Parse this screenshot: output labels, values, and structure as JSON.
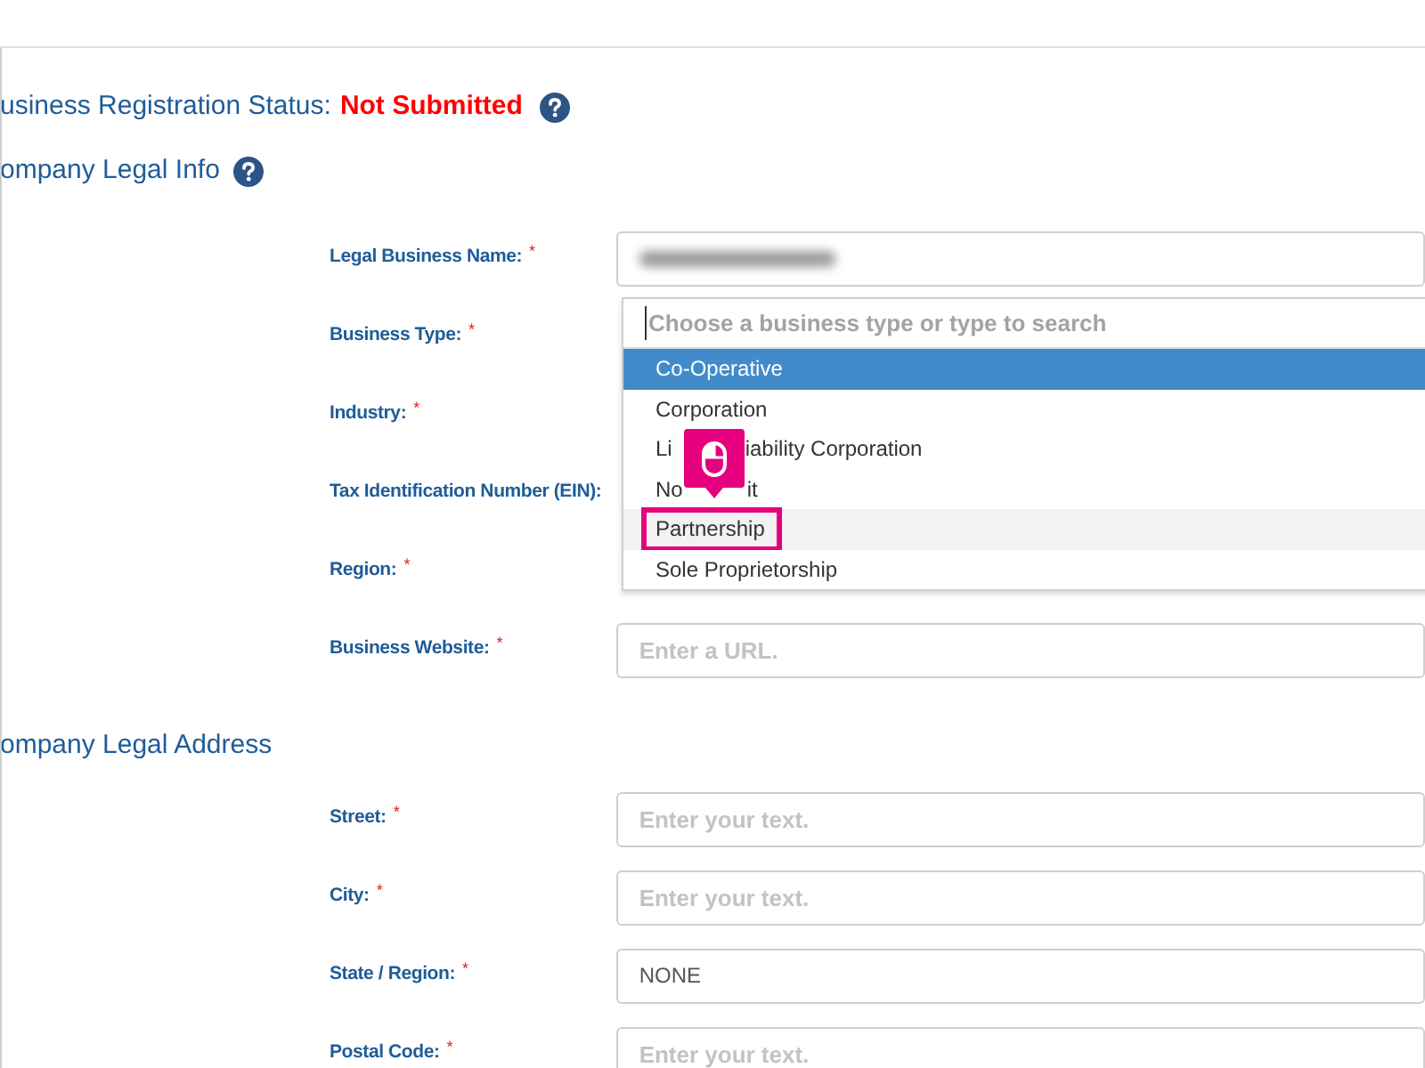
{
  "status": {
    "label": "usiness Registration Status:",
    "value": "Not Submitted",
    "help": true
  },
  "sections": [
    {
      "title": "ompany Legal Info",
      "help": true,
      "fields": [
        {
          "label": "Legal Business Name:",
          "marker": "*",
          "kind": "redacted"
        },
        {
          "label": "Business Type:",
          "marker": "*",
          "kind": "combobox",
          "placeholder": "Choose a business type or type to search",
          "options": [
            {
              "parts": [
                "Co-Operative"
              ],
              "selected": true,
              "annotated": false
            },
            {
              "parts": [
                "Corporation"
              ],
              "selected": false,
              "annotated": false
            },
            {
              "parts": [
                "Li",
                "iability Corporation"
              ],
              "selected": false,
              "annotated": false
            },
            {
              "parts": [
                "No",
                "it"
              ],
              "selected": false,
              "annotated": false
            },
            {
              "parts": [
                "Partnership"
              ],
              "selected": false,
              "annotated": true
            },
            {
              "parts": [
                "Sole Proprietorship"
              ],
              "selected": false,
              "annotated": false
            }
          ]
        },
        {
          "label": "Industry:",
          "marker": "*",
          "kind": "covered"
        },
        {
          "label": "Tax Identification Number (EIN):",
          "kind": "covered"
        },
        {
          "label": "Region:",
          "marker": "*",
          "kind": "covered"
        },
        {
          "label": "Business Website:",
          "marker": "*",
          "kind": "text",
          "placeholder": "Enter a URL."
        }
      ]
    },
    {
      "title": "ompany Legal Address",
      "help": false,
      "fields": [
        {
          "label": "Street:",
          "marker": "*",
          "kind": "text",
          "placeholder": "Enter your text."
        },
        {
          "label": "City:",
          "marker": "*",
          "kind": "text",
          "placeholder": "Enter your text."
        },
        {
          "label": "State / Region:",
          "marker": "*",
          "kind": "select",
          "value": "NONE"
        },
        {
          "label": "Postal Code:",
          "marker": "*",
          "kind": "text",
          "placeholder": "Enter your text."
        }
      ]
    }
  ]
}
